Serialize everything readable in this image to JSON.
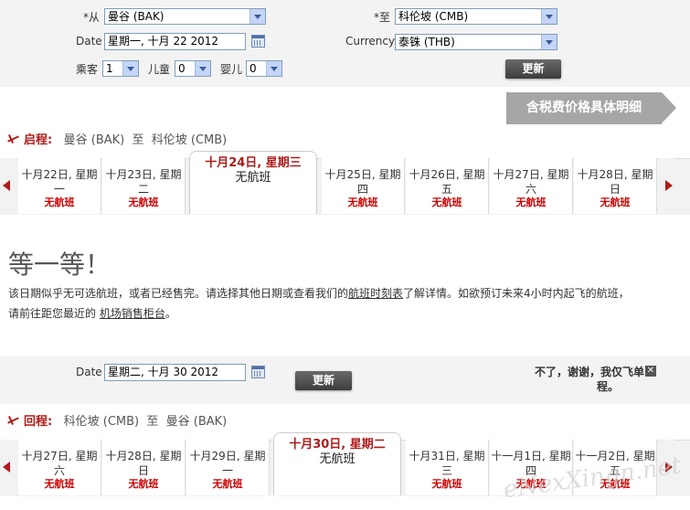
{
  "search": {
    "from_label": "*从",
    "from_value": "曼谷 (BAK)",
    "to_label": "*至",
    "to_value": "科伦坡 (CMB)",
    "date_label": "Date",
    "date_value": "星期一, 十月 22 2012",
    "currency_label": "Currency",
    "currency_value": "泰铢 (THB)",
    "adult_label": "乘客",
    "adult_value": "1",
    "child_label": "儿童",
    "child_value": "0",
    "infant_label": "婴儿",
    "infant_value": "0",
    "update_label": "更新"
  },
  "price_detail_button": "含税费价格具体明细",
  "outbound": {
    "dir_label": "启程:",
    "route_text": "曼谷 (BAK)  至  科伦坡 (CMB)",
    "days": [
      {
        "line1": "十月22日, 星期",
        "line2": "一",
        "status": "无航班"
      },
      {
        "line1": "十月23日, 星期",
        "line2": "二",
        "status": "无航班"
      },
      {
        "line1": "十月24日, 星期三",
        "line2": "",
        "status": "无航班"
      },
      {
        "line1": "十月25日, 星期",
        "line2": "四",
        "status": "无航班"
      },
      {
        "line1": "十月26日, 星期",
        "line2": "五",
        "status": "无航班"
      },
      {
        "line1": "十月27日, 星期",
        "line2": "六",
        "status": "无航班"
      },
      {
        "line1": "十月28日, 星期",
        "line2": "日",
        "status": "无航班"
      }
    ]
  },
  "notice": {
    "title": "等一等！",
    "text_1": "该日期似乎无可选航班，或者已经售完。请选择其他日期或查看我们的",
    "link_1": "航班时刻表",
    "text_2": "了解详情。如欲预订未来4小时内起飞的航班，",
    "text_3": "请前往距您最近的 ",
    "link_2": "机场销售柜台",
    "text_4": "。"
  },
  "return_search": {
    "date_label": "Date",
    "date_value": "星期二, 十月 30 2012",
    "update_label": "更新",
    "oneway_text_1": "不了，谢谢，我仅飞单",
    "oneway_text_2": "程。",
    "close_glyph": "✕"
  },
  "inbound": {
    "dir_label": "回程:",
    "route_text": "科伦坡 (CMB)  至  曼谷 (BAK)",
    "days": [
      {
        "line1": "十月27日, 星期",
        "line2": "六",
        "status": "无航班"
      },
      {
        "line1": "十月28日, 星期",
        "line2": "日",
        "status": "无航班"
      },
      {
        "line1": "十月29日, 星期",
        "line2": "一",
        "status": "无航班"
      },
      {
        "line1": "十月30日, 星期二",
        "line2": "",
        "status": "无航班"
      },
      {
        "line1": "十月31日, 星期",
        "line2": "三",
        "status": "无航班"
      },
      {
        "line1": "十一月1日, 星期",
        "line2": "四",
        "status": "无航班"
      },
      {
        "line1": "十一月2日, 星期",
        "line2": "五",
        "status": "无航班"
      }
    ]
  },
  "watermark": "eNexXingn.net",
  "colors": {
    "accent": "#b01a1a",
    "panel": "#f3f3f3",
    "button": "#4a4a4a",
    "big_button": "#a6a6a6"
  }
}
